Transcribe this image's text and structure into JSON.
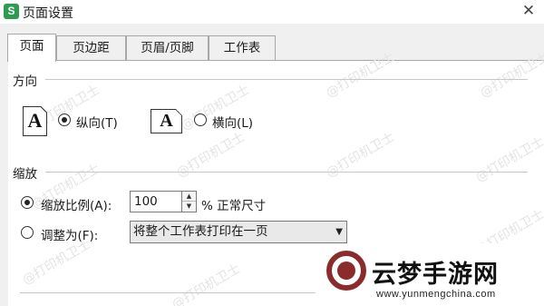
{
  "window": {
    "app_icon_letter": "S",
    "title": "页面设置",
    "close_glyph": "✕"
  },
  "tabs": [
    {
      "label": "页面",
      "active": true
    },
    {
      "label": "页边距",
      "active": false
    },
    {
      "label": "页眉/页脚",
      "active": false
    },
    {
      "label": "工作表",
      "active": false
    }
  ],
  "orientation": {
    "section_title": "方向",
    "portrait": {
      "icon_glyph": "A",
      "label": "纵向(T)",
      "checked": true
    },
    "landscape": {
      "icon_glyph": "A",
      "label": "横向(L)",
      "checked": false
    }
  },
  "scaling": {
    "section_title": "缩放",
    "scale_option": {
      "label": "缩放比例(A):",
      "checked": true
    },
    "scale_value": "100",
    "scale_suffix": "% 正常尺寸",
    "fit_option": {
      "label": "调整为(F):",
      "checked": false
    },
    "fit_selected": "将整个工作表打印在一页",
    "spin_up_glyph": "▲",
    "spin_down_glyph": "▼",
    "dropdown_glyph": "▼"
  },
  "watermark_text": "@打印机卫士",
  "promo": {
    "name": "云梦手游网",
    "url": "www.yunmengchina.com"
  },
  "colors": {
    "app_icon": "#2e9b52",
    "promo_logo": "#8a2c2c"
  }
}
